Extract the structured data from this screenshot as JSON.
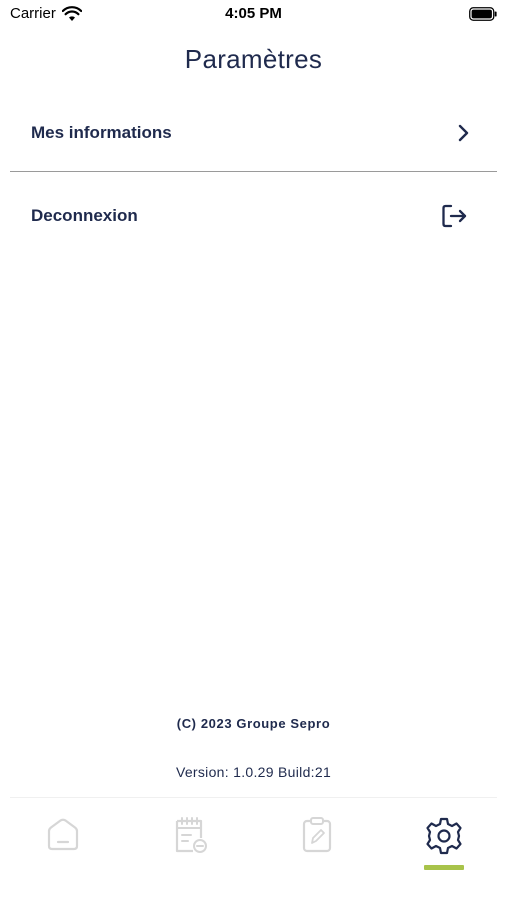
{
  "status_bar": {
    "carrier": "Carrier",
    "time": "4:05 PM"
  },
  "page": {
    "title": "Paramètres"
  },
  "menu": {
    "items": [
      {
        "label": "Mes informations",
        "icon": "chevron-right-icon"
      },
      {
        "label": "Deconnexion",
        "icon": "logout-icon"
      }
    ]
  },
  "footer": {
    "copyright": "(C) 2023 Groupe Sepro",
    "version": "Version: 1.0.29 Build:21"
  },
  "tab_bar": {
    "tabs": [
      {
        "icon": "home-icon",
        "active": false
      },
      {
        "icon": "calendar-icon",
        "active": false
      },
      {
        "icon": "clipboard-icon",
        "active": false
      },
      {
        "icon": "settings-gear-icon",
        "active": true
      }
    ],
    "accent_color": "#a8c34a",
    "inactive_color": "#d6d6d6",
    "active_color": "#1f2a4d"
  }
}
